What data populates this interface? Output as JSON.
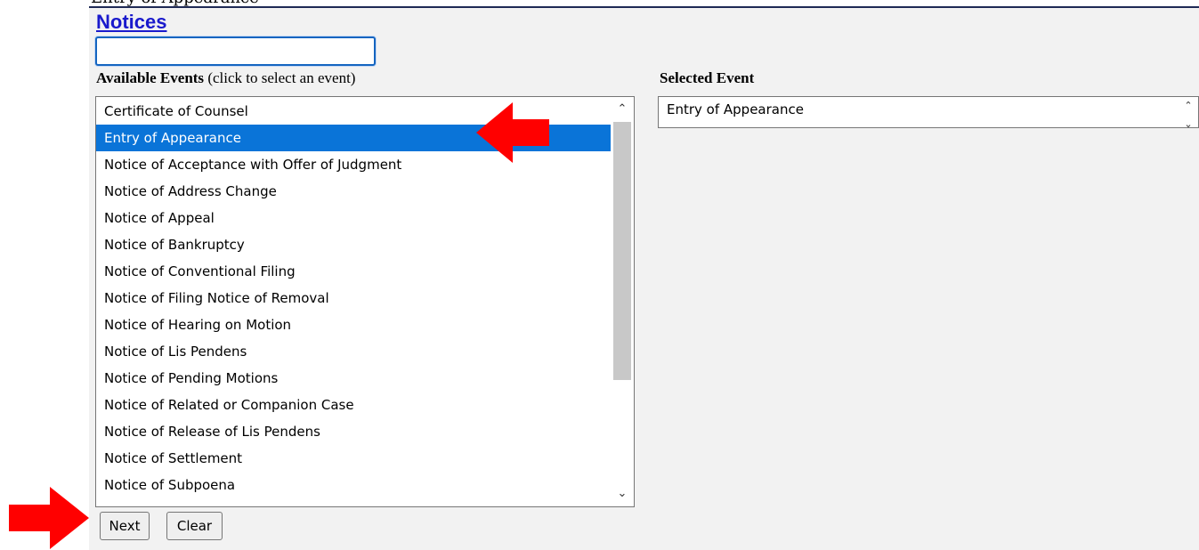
{
  "header": {
    "top_fragment": "Entry of Appearance",
    "title": "Notices"
  },
  "search": {
    "value": "",
    "placeholder": ""
  },
  "available": {
    "label_bold": "Available Events",
    "label_rest": " (click to select an event)",
    "items": [
      "Certificate of Counsel",
      "Entry of Appearance",
      "Notice of Acceptance with Offer of Judgment",
      "Notice of Address Change",
      "Notice of Appeal",
      "Notice of Bankruptcy",
      "Notice of Conventional Filing",
      "Notice of Filing Notice of Removal",
      "Notice of Hearing on Motion",
      "Notice of Lis Pendens",
      "Notice of Pending Motions",
      "Notice of Related or Companion Case",
      "Notice of Release of Lis Pendens",
      "Notice of Settlement",
      "Notice of Subpoena"
    ],
    "selected_index": 1
  },
  "selected": {
    "label": "Selected Event",
    "value": "Entry of Appearance"
  },
  "buttons": {
    "next": "Next",
    "clear": "Clear"
  },
  "icons": {
    "scroll_up": "chevron-up-icon",
    "scroll_down": "chevron-down-icon",
    "annotation_arrows": "red-arrow-icon"
  },
  "colors": {
    "selection": "#0a74d8",
    "heading": "#1a1acc",
    "annotation": "#ff0000"
  }
}
